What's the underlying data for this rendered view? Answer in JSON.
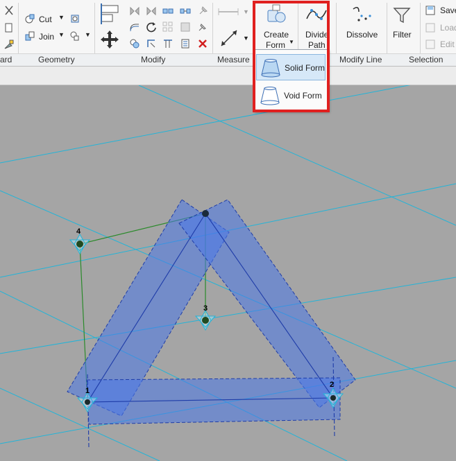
{
  "ribbon": {
    "panels": {
      "clipboard": "ard",
      "geometry": "Geometry",
      "modify": "Modify",
      "measure": "Measure",
      "modify_line": "Modify Line",
      "selection": "Selection"
    },
    "geometry": {
      "cut_label": "Cut",
      "join_label": "Join"
    },
    "form": {
      "create_form_line1": "Create",
      "create_form_line2": "Form",
      "divide_path_line1": "Divide",
      "divide_path_line2": "Path"
    },
    "modify_line": {
      "dissolve_label": "Dissolve"
    },
    "selection": {
      "filter_label": "Filter",
      "save_label": "Save",
      "load_label": "Load",
      "edit_label": "Edit"
    }
  },
  "dropdown": {
    "items": [
      {
        "label": "Solid Form"
      },
      {
        "label": "Void Form"
      }
    ]
  },
  "canvas": {
    "points": [
      {
        "label": "1"
      },
      {
        "label": "2"
      },
      {
        "label": "3"
      },
      {
        "label": "4"
      }
    ]
  },
  "colors": {
    "highlight": "#e0201f",
    "form_fill": "#4a78e8",
    "grid_line": "#22b4d8",
    "ref_line": "#2a8a2a"
  }
}
